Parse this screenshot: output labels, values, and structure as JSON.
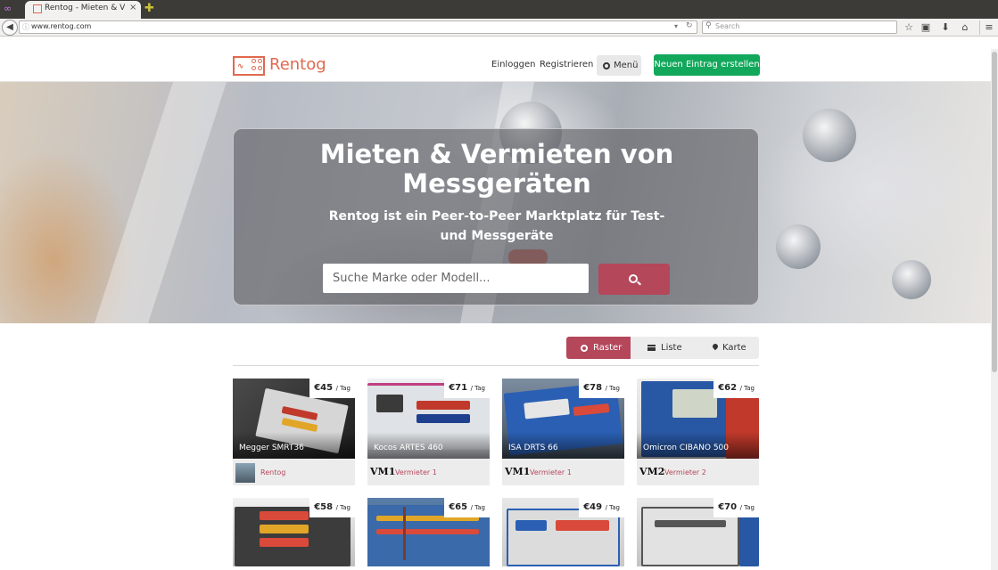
{
  "browser": {
    "tab_title": "Rentog - Mieten & V...",
    "tab_close": "×",
    "new_tab": "✚",
    "url": "www.rentog.com",
    "search_placeholder": "Search"
  },
  "header": {
    "logo_text": "Rentog",
    "login": "Einloggen",
    "register": "Registrieren",
    "menu": "Menü",
    "cta": "Neuen Eintrag erstellen"
  },
  "hero": {
    "title": "Mieten & Vermieten von Messgeräten",
    "subtitle": "Rentog ist ein Peer-to-Peer Marktplatz für Test- und Messgeräte",
    "search_placeholder": "Suche Marke oder Modell..."
  },
  "view_toggle": {
    "grid": "Raster",
    "list": "Liste",
    "map": "Karte",
    "active": "Raster"
  },
  "listings": [
    {
      "name": "Megger SMRT36",
      "price": "€45",
      "per": "/ Tag",
      "owner": "Rentog",
      "badge": ""
    },
    {
      "name": "Kocos ARTES 460",
      "price": "€71",
      "per": "/ Tag",
      "owner": "Vermieter 1",
      "badge": "VM1"
    },
    {
      "name": "ISA DRTS 66",
      "price": "€78",
      "per": "/ Tag",
      "owner": "Vermieter 1",
      "badge": "VM1"
    },
    {
      "name": "Omicron CIBANO 500",
      "price": "€62",
      "per": "/ Tag",
      "owner": "Vermieter 2",
      "badge": "VM2"
    },
    {
      "name": "",
      "price": "€58",
      "per": "/ Tag",
      "owner": "",
      "badge": ""
    },
    {
      "name": "",
      "price": "€65",
      "per": "/ Tag",
      "owner": "",
      "badge": ""
    },
    {
      "name": "",
      "price": "€49",
      "per": "/ Tag",
      "owner": "",
      "badge": ""
    },
    {
      "name": "",
      "price": "€70",
      "per": "/ Tag",
      "owner": "",
      "badge": ""
    }
  ],
  "colors": {
    "brand": "#e0694f",
    "accent": "#b5475b",
    "cta": "#12a85b"
  }
}
